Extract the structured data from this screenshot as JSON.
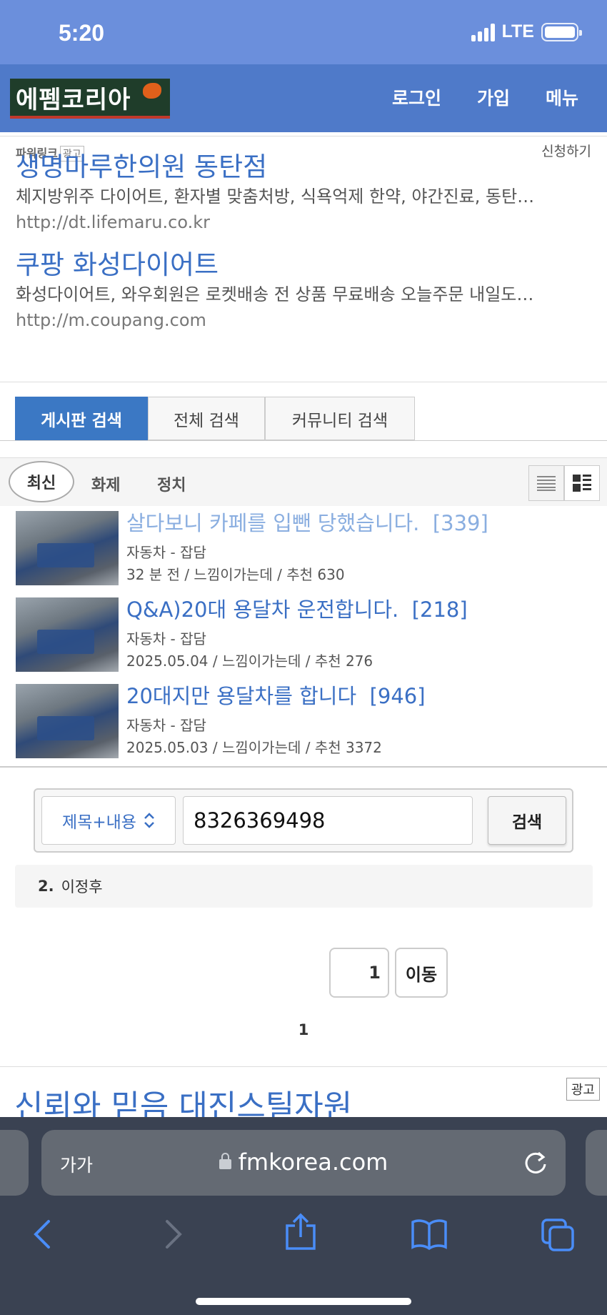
{
  "status_bar": {
    "time": "5:20",
    "network": "LTE"
  },
  "header": {
    "logo_text": "에펨코리아",
    "nav": {
      "login": "로그인",
      "join": "가입",
      "menu": "메뉴"
    }
  },
  "power_link": {
    "label": "파워링크",
    "ad_badge": "광고",
    "apply": "신청하기",
    "ads": [
      {
        "title": "생명마루한의원 동탄점",
        "desc": "체지방위주 다이어트, 환자별 맞춤처방, 식욕억제 한약, 야간진료, 동탄…",
        "url": "http://dt.lifemaru.co.kr"
      },
      {
        "title": "쿠팡 화성다이어트",
        "desc": "화성다이어트, 와우회원은 로켓배송 전 상품 무료배송 오늘주문 내일도…",
        "url": "http://m.coupang.com"
      }
    ]
  },
  "search_tabs": [
    "게시판 검색",
    "전체 검색",
    "커뮤니티 검색"
  ],
  "sort_tabs": [
    "최신",
    "화제",
    "정치"
  ],
  "posts": [
    {
      "title": "살다보니 카페를 입뺀 당했습니다.",
      "comments": "[339]",
      "category": "자동차 - 잡담",
      "meta": "32 분 전 / 느낌이가는데 / 추천 630"
    },
    {
      "title": "Q&A)20대 용달차 운전합니다.",
      "comments": "[218]",
      "category": "자동차 - 잡담",
      "meta": "2025.05.04 / 느낌이가는데 / 추천 276"
    },
    {
      "title": "20대지만 용달차를 합니다",
      "comments": "[946]",
      "category": "자동차 - 잡담",
      "meta": "2025.05.03 / 느낌이가는데 / 추천 3372"
    }
  ],
  "search_form": {
    "select_value": "제목+내용",
    "query": "8326369498",
    "button": "검색"
  },
  "result": {
    "index": "2.",
    "name": "이정후"
  },
  "pagination": {
    "page_input": "1",
    "go_button": "이동",
    "current_page": "1"
  },
  "bottom_ad": {
    "title": "신뢰와 믿음 대진스틸자원",
    "badge": "광고"
  },
  "safari": {
    "aa": "가가",
    "url": "fmkorea.com"
  },
  "colors": {
    "status_bar": "#6b8fdc",
    "header": "#4f7ac9",
    "link": "#3a6fc4",
    "active_tab": "#3b78c4",
    "safari_bg": "#3a4252"
  }
}
